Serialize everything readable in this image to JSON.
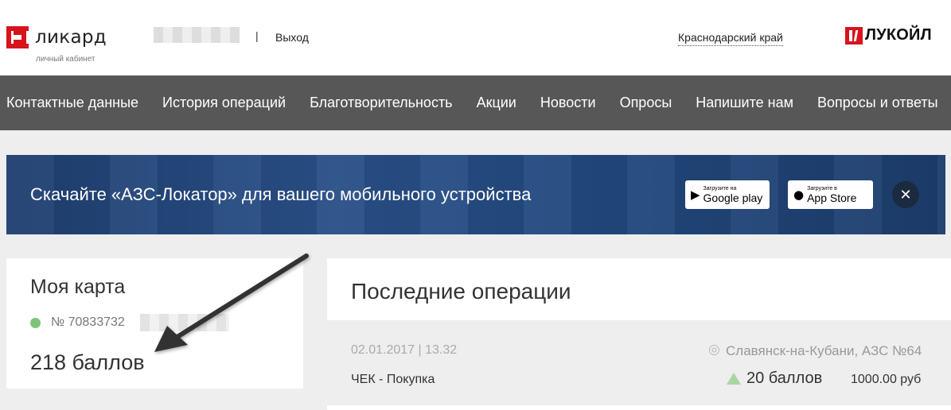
{
  "header": {
    "logo_text": "ликард",
    "logo_sub": "личный кабинет",
    "separator": "|",
    "logout": "Выход",
    "region": "Краснодарский край",
    "brand": "ЛУКОЙЛ"
  },
  "nav": {
    "items": [
      {
        "label": "Контактные данные"
      },
      {
        "label": "История операций"
      },
      {
        "label": "Благотворительность"
      },
      {
        "label": "Акции"
      },
      {
        "label": "Новости"
      },
      {
        "label": "Опросы"
      },
      {
        "label": "Напишите нам"
      },
      {
        "label": "Вопросы и ответы"
      }
    ]
  },
  "banner": {
    "text": "Скачайте «АЗС-Локатор» для вашего мобильного устройства",
    "google_small": "Загрузите на",
    "google_big": "Google play",
    "apple_small": "Загрузите в",
    "apple_big": "App Store",
    "close_icon": "close-icon"
  },
  "card": {
    "title": "Моя карта",
    "number": "№ 70833732",
    "points": "218 баллов",
    "status_color": "#7cc576"
  },
  "operations": {
    "title": "Последние операции",
    "items": [
      {
        "date": "02.01.2017 | 13.32",
        "location": "Славянск-на-Кубани, АЗС №64",
        "type": "ЧЕК - Покупка",
        "points": "20 баллов",
        "amount": "1000.00 руб"
      }
    ]
  },
  "colors": {
    "accent_red": "#d7131b",
    "nav_bg": "#575757",
    "page_bg": "#eeeeee"
  }
}
